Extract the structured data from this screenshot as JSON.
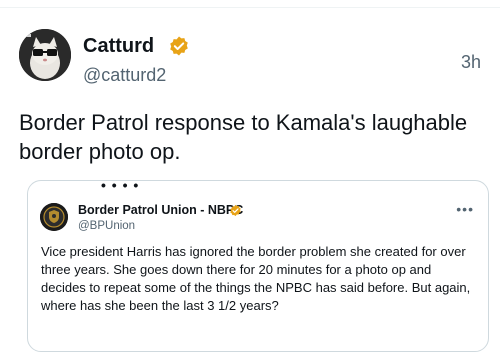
{
  "post": {
    "author_name": "Catturd",
    "author_handle": "@catturd2",
    "time_ago": "3h",
    "text": "Border Patrol response to Kamala's laughable border photo op."
  },
  "quoted": {
    "author_name": "Border Patrol Union - NBPC",
    "author_handle": "@BPUnion",
    "more_icon": "•••",
    "text": "Vice president Harris has ignored the border problem she created for over three years. She goes down there for 20 minutes for a photo op and decides to repeat some of the things the NPBC has said before. But again, where has she been the last 3 1/2 years?",
    "top_fragment": "• • • •"
  },
  "colors": {
    "verified_gold": "#e8a317",
    "muted_text": "#536471",
    "border": "#cfd9de"
  },
  "icons": {
    "verified": "verified-badge-icon",
    "more": "more-options-icon"
  }
}
